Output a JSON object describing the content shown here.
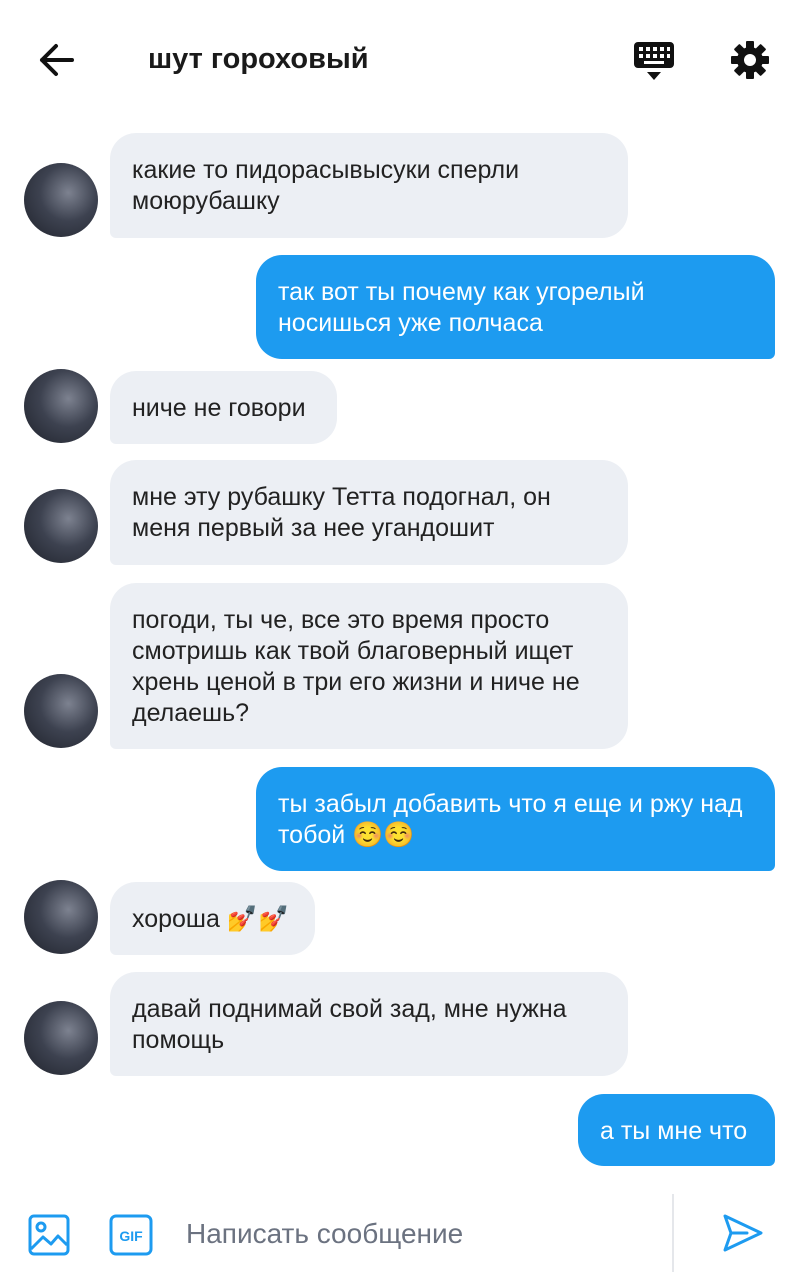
{
  "header": {
    "title": "шут гороховый"
  },
  "messages": [
    {
      "side": "in",
      "text": "какие то пидорасывысуки сперли моюрубашку"
    },
    {
      "side": "out",
      "text": "так вот ты почему как угорелый носишься уже полчаса"
    },
    {
      "side": "in",
      "text": "ниче не говори"
    },
    {
      "side": "in",
      "text": "мне эту рубашку Тетта подогнал, он меня первый за нее угандошит"
    },
    {
      "side": "in",
      "text": "погоди, ты че, все это время просто смотришь как твой благоверный ищет хрень ценой в три его жизни и ниче не делаешь?"
    },
    {
      "side": "out",
      "text": "ты забыл добавить что я еще и ржу над тобой ☺️☺️"
    },
    {
      "side": "in",
      "text": "хороша 💅💅"
    },
    {
      "side": "in",
      "text": "давай поднимай свой зад, мне нужна помощь"
    },
    {
      "side": "out",
      "text": "а ты мне что"
    }
  ],
  "composer": {
    "placeholder": "Написать сообщение",
    "gif_label": "GIF"
  },
  "colors": {
    "accent": "#1d9bf0",
    "incoming_bubble": "#eceff4",
    "text": "#222222"
  },
  "icons": {
    "back": "arrow-left-icon",
    "keyboard": "keyboard-icon",
    "settings": "gear-icon",
    "image": "image-icon",
    "gif": "gif-icon",
    "send": "send-icon"
  }
}
